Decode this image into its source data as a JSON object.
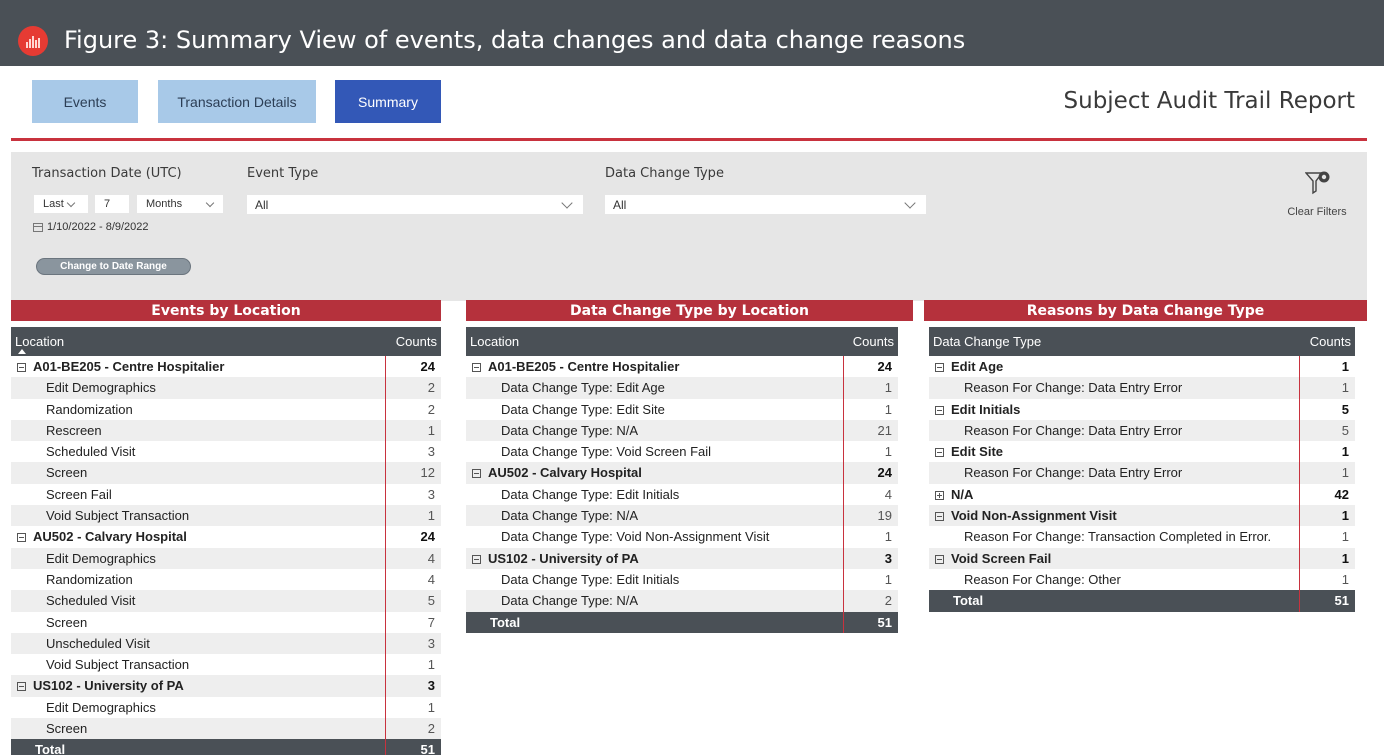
{
  "figure_title": "Figure 3: Summary View of events, data changes and data change reasons",
  "nav": {
    "events": "Events",
    "transaction_details": "Transaction Details",
    "summary": "Summary"
  },
  "report_title": "Subject Audit Trail Report",
  "filters": {
    "transaction_date_label": "Transaction Date (UTC)",
    "relative": "Last",
    "count": "7",
    "unit": "Months",
    "date_range": "1/10/2022 - 8/9/2022",
    "change_button": "Change to Date Range",
    "event_type_label": "Event Type",
    "event_type_value": "All",
    "data_change_type_label": "Data Change Type",
    "data_change_type_value": "All",
    "clear_filters": "Clear Filters"
  },
  "colors": {
    "accent_red": "#b5313c",
    "header_gray": "#4a5056",
    "active_tab": "#3358b7",
    "inactive_tab": "#a8c9e8"
  },
  "panels": [
    {
      "title": "Events by Location",
      "col1": "Location",
      "col2": "Counts",
      "rows": [
        {
          "kind": "group",
          "label": "A01-BE205 - Centre Hospitalier",
          "count": "24"
        },
        {
          "kind": "sub",
          "label": "Edit Demographics",
          "count": "2"
        },
        {
          "kind": "sub",
          "label": "Randomization",
          "count": "2"
        },
        {
          "kind": "sub",
          "label": "Rescreen",
          "count": "1"
        },
        {
          "kind": "sub",
          "label": "Scheduled Visit",
          "count": "3"
        },
        {
          "kind": "sub",
          "label": "Screen",
          "count": "12"
        },
        {
          "kind": "sub",
          "label": "Screen Fail",
          "count": "3"
        },
        {
          "kind": "sub",
          "label": "Void Subject Transaction",
          "count": "1"
        },
        {
          "kind": "group",
          "label": "AU502 - Calvary Hospital",
          "count": "24"
        },
        {
          "kind": "sub",
          "label": "Edit Demographics",
          "count": "4"
        },
        {
          "kind": "sub",
          "label": "Randomization",
          "count": "4"
        },
        {
          "kind": "sub",
          "label": "Scheduled Visit",
          "count": "5"
        },
        {
          "kind": "sub",
          "label": "Screen",
          "count": "7"
        },
        {
          "kind": "sub",
          "label": "Unscheduled Visit",
          "count": "3"
        },
        {
          "kind": "sub",
          "label": "Void Subject Transaction",
          "count": "1"
        },
        {
          "kind": "group",
          "label": "US102 - University of PA",
          "count": "3"
        },
        {
          "kind": "sub",
          "label": "Edit Demographics",
          "count": "1"
        },
        {
          "kind": "sub",
          "label": "Screen",
          "count": "2"
        },
        {
          "kind": "total",
          "label": "Total",
          "count": "51"
        }
      ]
    },
    {
      "title": "Data Change Type by Location",
      "col1": "Location",
      "col2": "Counts",
      "rows": [
        {
          "kind": "group",
          "label": "A01-BE205 - Centre Hospitalier",
          "count": "24"
        },
        {
          "kind": "sub",
          "label": "Data Change Type: Edit Age",
          "count": "1"
        },
        {
          "kind": "sub",
          "label": "Data Change Type: Edit Site",
          "count": "1"
        },
        {
          "kind": "sub",
          "label": "Data Change Type: N/A",
          "count": "21"
        },
        {
          "kind": "sub",
          "label": "Data Change Type: Void Screen Fail",
          "count": "1"
        },
        {
          "kind": "group",
          "label": "AU502 - Calvary Hospital",
          "count": "24"
        },
        {
          "kind": "sub",
          "label": "Data Change Type: Edit Initials",
          "count": "4"
        },
        {
          "kind": "sub",
          "label": "Data Change Type: N/A",
          "count": "19"
        },
        {
          "kind": "sub",
          "label": "Data Change Type: Void Non-Assignment Visit",
          "count": "1"
        },
        {
          "kind": "group",
          "label": "US102 - University of PA",
          "count": "3"
        },
        {
          "kind": "sub",
          "label": "Data Change Type: Edit Initials",
          "count": "1"
        },
        {
          "kind": "sub",
          "label": "Data Change Type: N/A",
          "count": "2"
        },
        {
          "kind": "total",
          "label": "Total",
          "count": "51"
        }
      ]
    },
    {
      "title": "Reasons by Data Change Type",
      "col1": "Data Change Type",
      "col2": "Counts",
      "rows": [
        {
          "kind": "group",
          "label": "Edit Age",
          "count": "1"
        },
        {
          "kind": "sub",
          "label": "Reason For Change: Data Entry Error",
          "count": "1"
        },
        {
          "kind": "group",
          "label": "Edit Initials",
          "count": "5"
        },
        {
          "kind": "sub",
          "label": "Reason For Change: Data Entry Error",
          "count": "5"
        },
        {
          "kind": "group",
          "label": "Edit Site",
          "count": "1"
        },
        {
          "kind": "sub",
          "label": "Reason For Change: Data Entry Error",
          "count": "1"
        },
        {
          "kind": "group",
          "collapsed": true,
          "label": "N/A",
          "count": "42"
        },
        {
          "kind": "group",
          "label": "Void Non-Assignment Visit",
          "count": "1"
        },
        {
          "kind": "sub",
          "label": "Reason For Change: Transaction Completed in Error.",
          "count": "1"
        },
        {
          "kind": "group",
          "label": "Void Screen Fail",
          "count": "1"
        },
        {
          "kind": "sub",
          "label": "Reason For Change: Other",
          "count": "1"
        },
        {
          "kind": "total",
          "label": "Total",
          "count": "51"
        }
      ]
    }
  ]
}
